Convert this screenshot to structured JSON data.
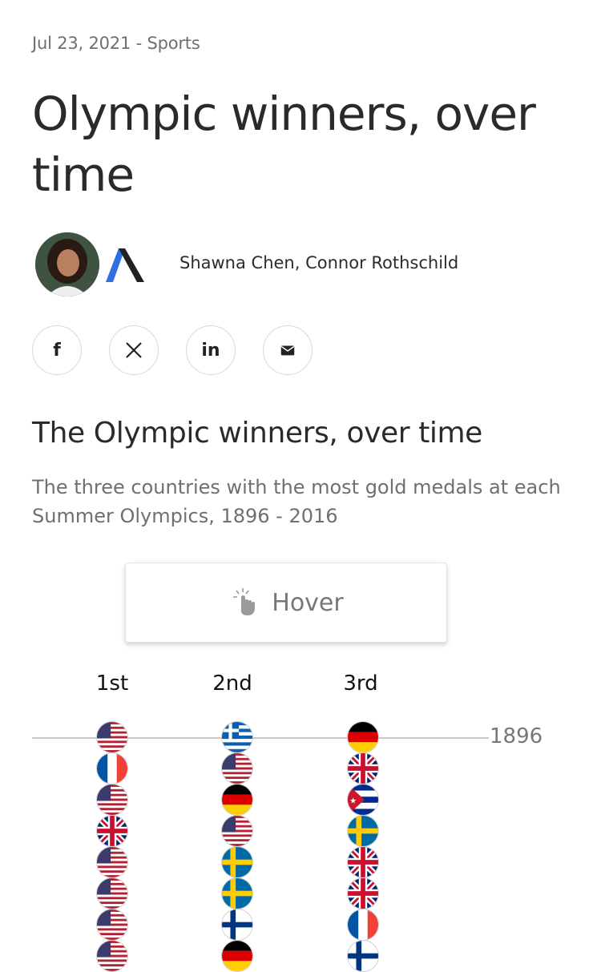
{
  "article": {
    "meta": "Jul 23, 2021 - Sports",
    "title": "Olympic winners, over time",
    "authors": "Shawna Chen, Connor Rothschild"
  },
  "share": [
    {
      "name": "facebook-share-button",
      "icon": "facebook-icon"
    },
    {
      "name": "x-share-button",
      "icon": "x-icon"
    },
    {
      "name": "linkedin-share-button",
      "icon": "linkedin-icon"
    },
    {
      "name": "email-share-button",
      "icon": "email-icon"
    }
  ],
  "chart": {
    "title": "The Olympic winners, over time",
    "description": "The three countries with the most gold medals at each Summer Olympics, 1896 - 2016",
    "hover_label": "Hover",
    "rank_labels": [
      "1st",
      "2nd",
      "3rd"
    ],
    "year_label": "1896",
    "columns": [
      [
        "usa",
        "france",
        "usa",
        "uk",
        "usa",
        "usa",
        "usa",
        "usa"
      ],
      [
        "greece",
        "usa",
        "germany",
        "usa",
        "sweden",
        "sweden",
        "finland",
        "germany"
      ],
      [
        "germany",
        "uk",
        "cuba",
        "sweden",
        "uk",
        "uk",
        "france",
        "finland"
      ]
    ]
  }
}
